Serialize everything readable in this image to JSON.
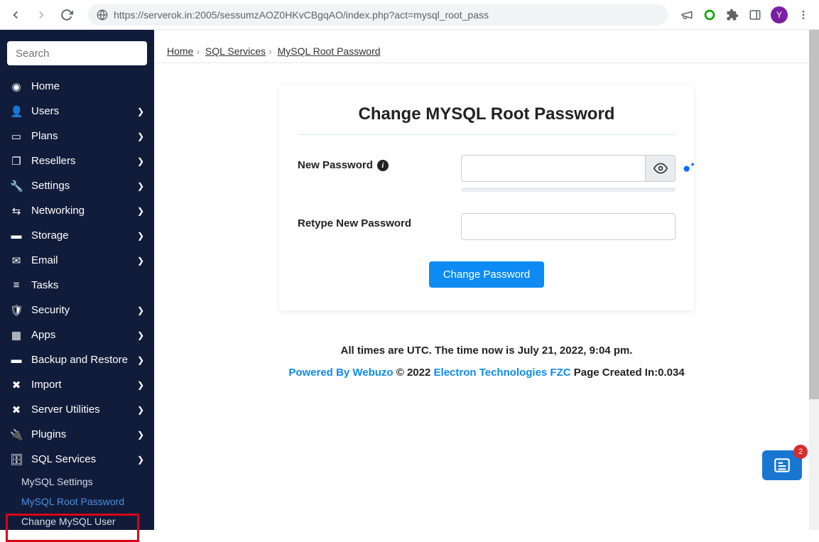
{
  "browser": {
    "url": "https://serverok.in:2005/sessumzAOZ0HKvCBgqAO/index.php?act=mysql_root_pass",
    "avatar_letter": "Y"
  },
  "sidebar": {
    "search_placeholder": "Search",
    "items": [
      {
        "label": "Home",
        "expandable": false
      },
      {
        "label": "Users",
        "expandable": true
      },
      {
        "label": "Plans",
        "expandable": true
      },
      {
        "label": "Resellers",
        "expandable": true
      },
      {
        "label": "Settings",
        "expandable": true
      },
      {
        "label": "Networking",
        "expandable": true
      },
      {
        "label": "Storage",
        "expandable": true
      },
      {
        "label": "Email",
        "expandable": true
      },
      {
        "label": "Tasks",
        "expandable": false
      },
      {
        "label": "Security",
        "expandable": true
      },
      {
        "label": "Apps",
        "expandable": true
      },
      {
        "label": "Backup and Restore",
        "expandable": true
      },
      {
        "label": "Import",
        "expandable": true
      },
      {
        "label": "Server Utilities",
        "expandable": true
      },
      {
        "label": "Plugins",
        "expandable": true
      },
      {
        "label": "SQL Services",
        "expandable": true
      }
    ],
    "sub_items": [
      {
        "label": "MySQL Settings",
        "active": false
      },
      {
        "label": "MySQL Root Password",
        "active": true
      },
      {
        "label": "Change MySQL User",
        "active": false
      }
    ]
  },
  "breadcrumb": {
    "items": [
      "Home",
      "SQL Services",
      "MySQL Root Password"
    ]
  },
  "card": {
    "title": "Change MYSQL Root Password",
    "new_password_label": "New Password",
    "retype_label": "Retype New Password",
    "button": "Change Password"
  },
  "footer": {
    "time_line": "All times are UTC. The time now is July 21, 2022, 9:04 pm.",
    "powered_by": "Powered By Webuzo",
    "copyright": " © 2022 ",
    "company": "Electron Technologies FZC",
    "page_created": "   Page Created In:0.034"
  },
  "float": {
    "count": "2"
  }
}
